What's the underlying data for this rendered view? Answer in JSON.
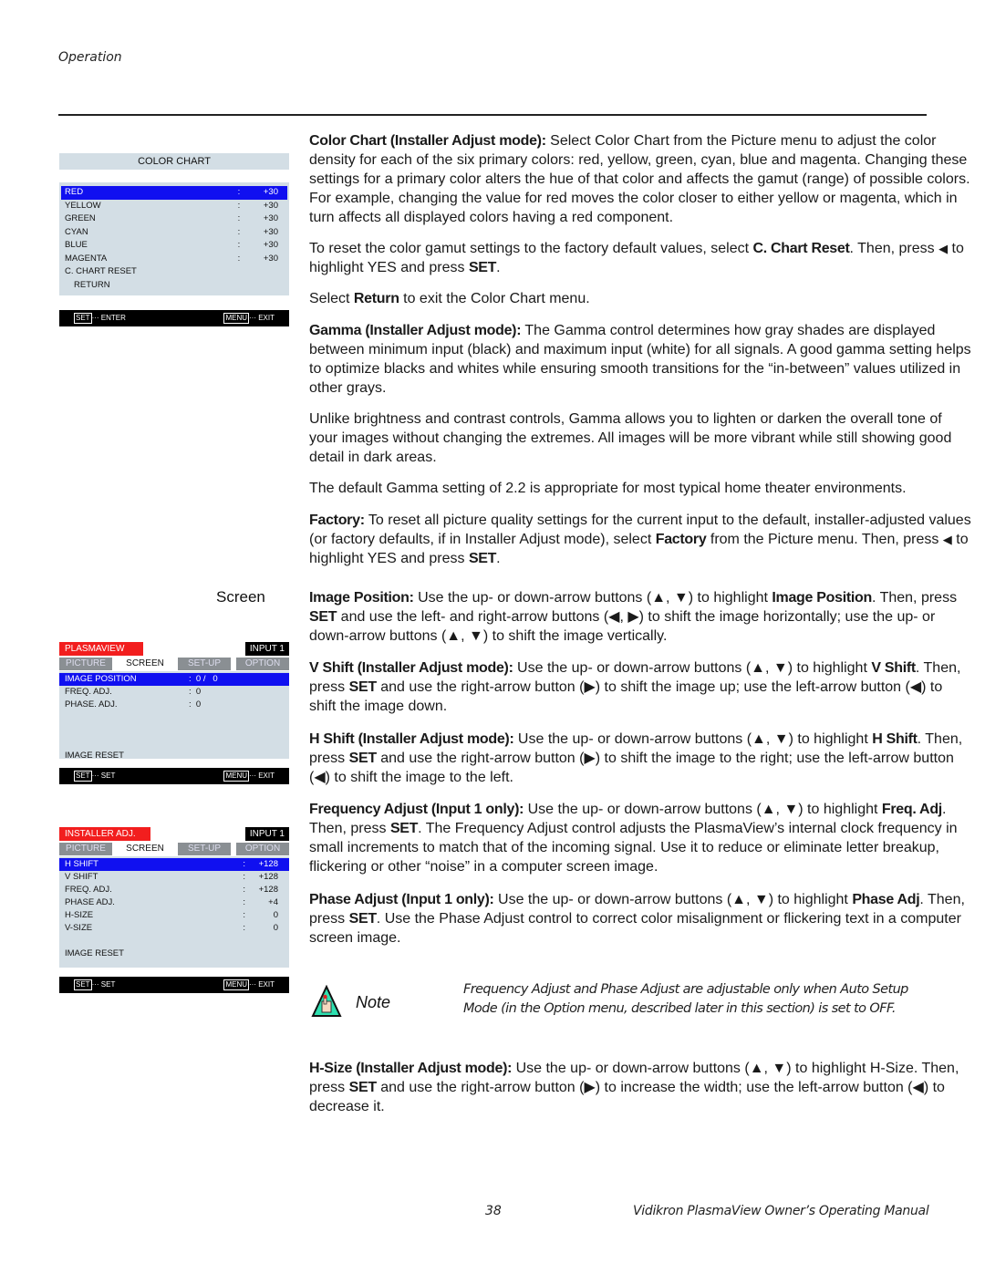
{
  "header": {
    "section": "Operation"
  },
  "color_chart_menu": {
    "title": "COLOR CHART",
    "rows": [
      {
        "label": "RED",
        "sep": ":",
        "value": "+30",
        "selected": true
      },
      {
        "label": "YELLOW",
        "sep": ":",
        "value": "+30"
      },
      {
        "label": "GREEN",
        "sep": ":",
        "value": "+30"
      },
      {
        "label": "CYAN",
        "sep": ":",
        "value": "+30"
      },
      {
        "label": "BLUE",
        "sep": ":",
        "value": "+30"
      },
      {
        "label": "MAGENTA",
        "sep": ":",
        "value": "+30"
      },
      {
        "label": "C. CHART RESET",
        "sep": "",
        "value": ""
      },
      {
        "label": "RETURN",
        "sep": "",
        "value": ""
      }
    ],
    "footer": {
      "left_key": "SET",
      "left_action": "··· ENTER",
      "right_key": "MENU",
      "right_action": "··· EXIT"
    }
  },
  "screen_heading": "Screen",
  "screen_menu": {
    "brand": "PLASMAVIEW",
    "input": "INPUT 1",
    "tabs": [
      "PICTURE",
      "SCREEN",
      "SET-UP",
      "OPTION"
    ],
    "active_tab": "SCREEN",
    "rows": [
      {
        "label": "IMAGE POSITION",
        "value": ":  0 /   0",
        "selected": true
      },
      {
        "label": "FREQ. ADJ.",
        "value": ":  0"
      },
      {
        "label": "PHASE. ADJ.",
        "value": ":  0"
      }
    ],
    "reset": "IMAGE RESET",
    "footer": {
      "left_key": "SET",
      "left_action": "··· SET",
      "right_key": "MENU",
      "right_action": "··· EXIT"
    }
  },
  "installer_menu": {
    "brand": "INSTALLER ADJ.",
    "input": "INPUT 1",
    "tabs": [
      "PICTURE",
      "SCREEN",
      "SET-UP",
      "OPTION"
    ],
    "active_tab": "SCREEN",
    "rows": [
      {
        "label": "H SHIFT",
        "sep": ":",
        "value": "+128",
        "selected": true
      },
      {
        "label": "V SHIFT",
        "sep": ":",
        "value": "+128"
      },
      {
        "label": "FREQ. ADJ.",
        "sep": ":",
        "value": "+128"
      },
      {
        "label": "PHASE ADJ.",
        "sep": ":",
        "value": "+4"
      },
      {
        "label": "H-SIZE",
        "sep": ":",
        "value": "0"
      },
      {
        "label": "V-SIZE",
        "sep": ":",
        "value": "0"
      }
    ],
    "reset": "IMAGE RESET",
    "footer": {
      "left_key": "SET",
      "left_action": "··· SET",
      "right_key": "MENU",
      "right_action": "··· EXIT"
    }
  },
  "paragraphs": {
    "color_chart": {
      "term": "Color Chart (Installer Adjust mode):",
      "text": " Select Color Chart from the Picture menu to adjust the color density for each of the six primary colors: red, yellow, green, cyan, blue and magenta. Changing these settings for a primary color alters the hue of that color and affects the gamut (range) of possible colors. For example, changing the value for red moves the color closer to either yellow or magenta, which in turn affects all displayed colors having a red component."
    },
    "color_reset": {
      "pre": "To reset the color gamut settings to the factory default values, select ",
      "term": "C. Chart Reset",
      "mid": ". Then, press ",
      "arrow": "◀",
      "post": " to highlight YES and press ",
      "key": "SET",
      "end": "."
    },
    "return": {
      "pre": "Select ",
      "term": "Return",
      "post": " to exit the Color Chart menu."
    },
    "gamma": {
      "term": "Gamma (Installer Adjust mode):",
      "text": " The Gamma control determines how gray shades are displayed between minimum input (black) and maximum input (white) for all signals. A good gamma setting helps to optimize blacks and whites while ensuring smooth transitions for the “in-between” values utilized in other grays."
    },
    "gamma2": {
      "text": "Unlike brightness and contrast controls, Gamma allows you to lighten or darken the overall tone of your images without changing the extremes. All images will be more vibrant while still showing good detail in dark areas."
    },
    "gamma3": {
      "text": "The default Gamma setting of 2.2 is appropriate for most typical home theater environments."
    },
    "factory": {
      "term": "Factory:",
      "pre": " To reset all picture quality settings for the current input to the default, installer-adjusted values (or factory defaults, if in Installer Adjust mode), select ",
      "term2": "Factory",
      "mid": " from the Picture menu. Then, press ",
      "arrow": "◀",
      "post": " to highlight YES and press ",
      "key": "SET",
      "end": "."
    },
    "image_position": {
      "term": "Image Position:",
      "t1": " Use the up- or down-arrow buttons (▲, ▼) to highlight ",
      "term2": "Image Position",
      "t2": ". Then, press ",
      "key": "SET",
      "t3": " and use the left- and right-arrow buttons (◀, ▶) to shift the image horizontally; use the up- or down-arrow buttons (▲, ▼) to shift the image vertically."
    },
    "v_shift": {
      "term": "V Shift (Installer Adjust mode):",
      "t1": " Use the up- or down-arrow buttons (▲, ▼) to highlight ",
      "term2": "V Shift",
      "t2": ". Then, press ",
      "key": "SET",
      "t3": " and use the right-arrow button (▶) to shift the image up; use the left-arrow button (◀) to shift the image down."
    },
    "h_shift": {
      "term": "H Shift (Installer Adjust mode):",
      "t1": " Use the up- or down-arrow buttons (▲, ▼) to highlight ",
      "term2": "H Shift",
      "t2": ". Then, press ",
      "key": "SET",
      "t3": " and use the right-arrow button (▶) to shift the image to the right; use the left-arrow button (◀) to shift the image to the left."
    },
    "freq": {
      "term": "Frequency Adjust (Input 1 only):",
      "t1": " Use the up- or down-arrow buttons (▲, ▼) to highlight ",
      "term2": "Freq. Adj",
      "t2": ". Then, press ",
      "key": "SET",
      "t3": ". The Frequency Adjust control adjusts the PlasmaView’s internal clock frequency in small increments to match that of the incoming signal. Use it to reduce or eliminate letter breakup, flickering or other “noise” in a computer screen image."
    },
    "phase": {
      "term": "Phase Adjust (Input 1 only):",
      "t1": " Use the up- or down-arrow buttons (▲, ▼) to highlight ",
      "term2": "Phase Adj",
      "t2": ". Then, press ",
      "key": "SET",
      "t3": ". Use the Phase Adjust control to correct color misalignment or flickering text in a computer screen image."
    },
    "h_size": {
      "term": "H-Size (Installer Adjust mode):",
      "t1": " Use the up- or down-arrow buttons (▲, ▼) to highlight H-Size. Then, press ",
      "key": "SET",
      "t3": " and use the right-arrow button (▶) to increase the width; use the left-arrow button (◀) to decrease it."
    }
  },
  "note": {
    "label": "Note",
    "text": "Frequency Adjust and Phase Adjust are adjustable only when Auto Setup Mode (in the Option menu, described later in this section) is set to OFF."
  },
  "footer": {
    "page_number": "38",
    "manual_title": "Vidikron PlasmaView Owner’s Operating Manual"
  }
}
